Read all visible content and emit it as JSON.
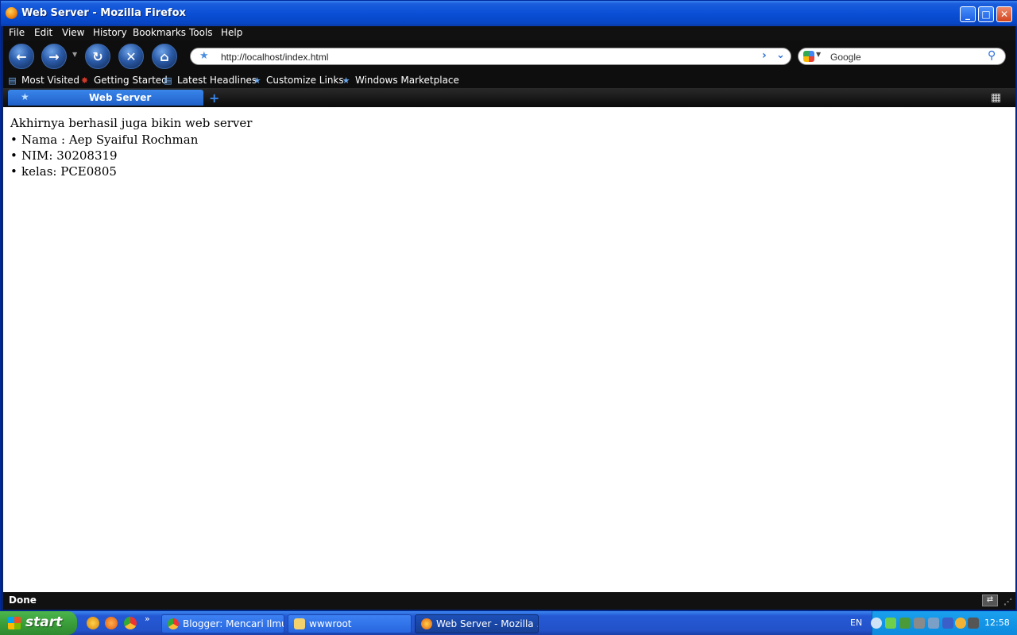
{
  "window": {
    "title": "Web Server - Mozilla Firefox"
  },
  "menubar": {
    "items": [
      "File",
      "Edit",
      "View",
      "History",
      "Bookmarks",
      "Tools",
      "Help"
    ]
  },
  "navigation": {
    "url": "http://localhost/index.html",
    "search_engine": "Google",
    "buttons": [
      "back-icon",
      "forward-icon",
      "reload-icon",
      "stop-icon",
      "home-icon"
    ]
  },
  "bookmarks": {
    "items": [
      {
        "label": "Most Visited",
        "icon": "most-visited-icon"
      },
      {
        "label": "Getting Started",
        "icon": "getting-started-icon"
      },
      {
        "label": "Latest Headlines",
        "icon": "rss-folder-icon"
      },
      {
        "label": "Customize Links",
        "icon": "star-icon"
      },
      {
        "label": "Windows Marketplace",
        "icon": "star-icon"
      }
    ]
  },
  "tabs": [
    {
      "label": "Web Server",
      "active": true
    }
  ],
  "page": {
    "heading": "Akhirnya berhasil juga bikin web server",
    "items": [
      "Nama : Aep Syaiful Rochman",
      "NIM: 30208319",
      "kelas: PCE0805"
    ]
  },
  "status": {
    "text": "Done"
  },
  "taskbar": {
    "start_label": "start",
    "tasks": [
      "Blogger: Mencari Ilmu...",
      "wwwroot",
      "Web Server - Mozilla ..."
    ],
    "language": "EN",
    "clock": "12:58"
  },
  "colors": {
    "titlebar": "#0a4fd6",
    "taskbar": "#2459d4",
    "start": "#3a9f3a",
    "tray": "#0c8ade"
  }
}
